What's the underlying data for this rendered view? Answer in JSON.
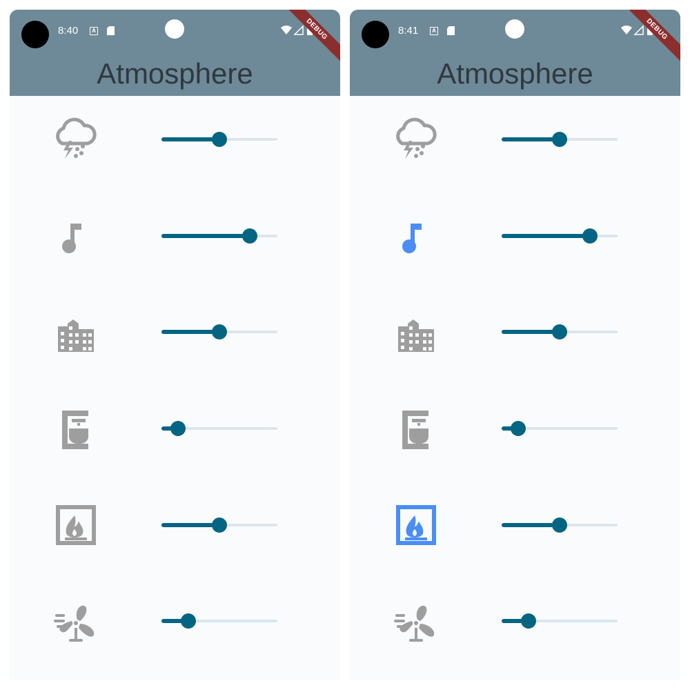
{
  "colors": {
    "appbar": "#6e8a98",
    "page_bg": "#f9fbfd",
    "slider_active": "#046582",
    "slider_inactive": "#dde5ec",
    "icon_inactive": "#9e9e9e",
    "icon_active": "#4a8ef5",
    "title_text": "#30383f",
    "debug_banner": "#8b2e2e"
  },
  "screens": [
    {
      "status": {
        "time": "8:40",
        "a_badge": "A"
      },
      "debug_label": "DEBUG",
      "title": "Atmosphere",
      "sounds": [
        {
          "icon": "thunderstorm-icon",
          "active": false,
          "level": 0.5
        },
        {
          "icon": "music-note-icon",
          "active": false,
          "level": 0.76
        },
        {
          "icon": "city-building-icon",
          "active": false,
          "level": 0.5
        },
        {
          "icon": "coffee-maker-icon",
          "active": false,
          "level": 0.14
        },
        {
          "icon": "fireplace-icon",
          "active": false,
          "level": 0.5
        },
        {
          "icon": "fan-icon",
          "active": false,
          "level": 0.23
        }
      ]
    },
    {
      "status": {
        "time": "8:41",
        "a_badge": "A"
      },
      "debug_label": "DEBUG",
      "title": "Atmosphere",
      "sounds": [
        {
          "icon": "thunderstorm-icon",
          "active": false,
          "level": 0.5
        },
        {
          "icon": "music-note-icon",
          "active": true,
          "level": 0.76
        },
        {
          "icon": "city-building-icon",
          "active": false,
          "level": 0.5
        },
        {
          "icon": "coffee-maker-icon",
          "active": false,
          "level": 0.14
        },
        {
          "icon": "fireplace-icon",
          "active": true,
          "level": 0.5
        },
        {
          "icon": "fan-icon",
          "active": false,
          "level": 0.23
        }
      ]
    }
  ]
}
